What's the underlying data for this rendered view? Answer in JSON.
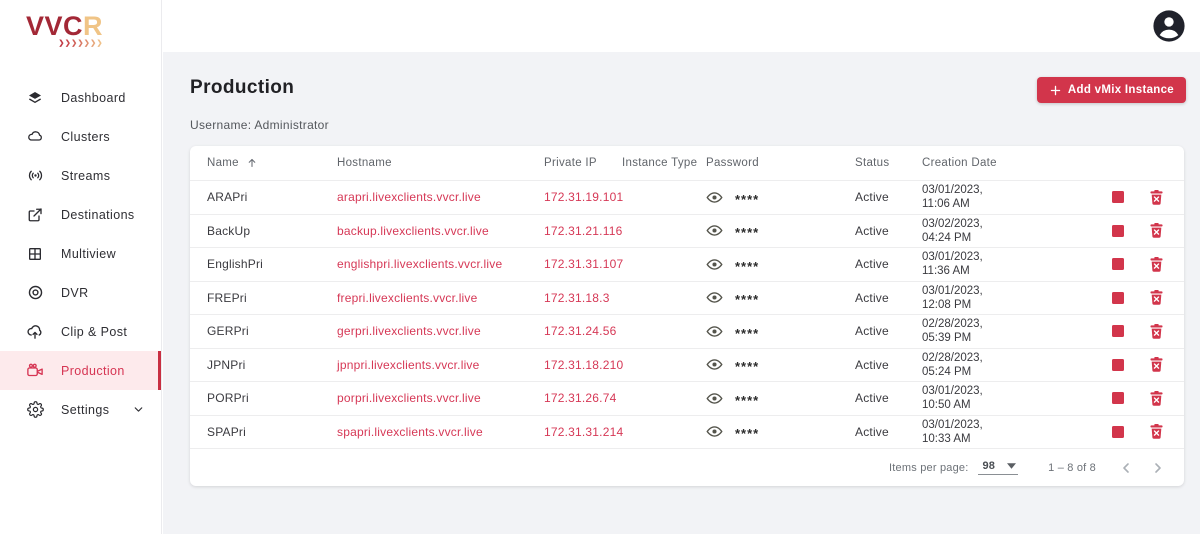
{
  "brand": {
    "logo_text_primary": "VVC",
    "logo_text_accent": "R",
    "logo_chevrons": "❯❯❯❯❯❯❯"
  },
  "sidebar": {
    "items": [
      {
        "label": "Dashboard"
      },
      {
        "label": "Clusters"
      },
      {
        "label": "Streams"
      },
      {
        "label": "Destinations"
      },
      {
        "label": "Multiview"
      },
      {
        "label": "DVR"
      },
      {
        "label": "Clip & Post"
      },
      {
        "label": "Production",
        "active": true
      },
      {
        "label": "Settings"
      }
    ]
  },
  "page": {
    "title": "Production",
    "subtitle": "Username: Administrator",
    "add_button_label": "Add vMix Instance"
  },
  "table": {
    "columns": [
      "Name",
      "Hostname",
      "Private IP",
      "Instance Type",
      "Password",
      "Status",
      "Creation Date"
    ],
    "rows": [
      {
        "name": "ARAPri",
        "hostname": "arapri.livexclients.vvcr.live",
        "private_ip": "172.31.19.101",
        "instance_type": "",
        "password": "****",
        "status": "Active",
        "creation_date_line1": "03/01/2023,",
        "creation_date_line2": "11:06 AM"
      },
      {
        "name": "BackUp",
        "hostname": "backup.livexclients.vvcr.live",
        "private_ip": "172.31.21.116",
        "instance_type": "",
        "password": "****",
        "status": "Active",
        "creation_date_line1": "03/02/2023,",
        "creation_date_line2": "04:24 PM"
      },
      {
        "name": "EnglishPri",
        "hostname": "englishpri.livexclients.vvcr.live",
        "private_ip": "172.31.31.107",
        "instance_type": "",
        "password": "****",
        "status": "Active",
        "creation_date_line1": "03/01/2023,",
        "creation_date_line2": "11:36 AM"
      },
      {
        "name": "FREPri",
        "hostname": "frepri.livexclients.vvcr.live",
        "private_ip": "172.31.18.3",
        "instance_type": "",
        "password": "****",
        "status": "Active",
        "creation_date_line1": "03/01/2023,",
        "creation_date_line2": "12:08 PM"
      },
      {
        "name": "GERPri",
        "hostname": "gerpri.livexclients.vvcr.live",
        "private_ip": "172.31.24.56",
        "instance_type": "",
        "password": "****",
        "status": "Active",
        "creation_date_line1": "02/28/2023,",
        "creation_date_line2": "05:39 PM"
      },
      {
        "name": "JPNPri",
        "hostname": "jpnpri.livexclients.vvcr.live",
        "private_ip": "172.31.18.210",
        "instance_type": "",
        "password": "****",
        "status": "Active",
        "creation_date_line1": "02/28/2023,",
        "creation_date_line2": "05:24 PM"
      },
      {
        "name": "PORPri",
        "hostname": "porpri.livexclients.vvcr.live",
        "private_ip": "172.31.26.74",
        "instance_type": "",
        "password": "****",
        "status": "Active",
        "creation_date_line1": "03/01/2023,",
        "creation_date_line2": "10:50 AM"
      },
      {
        "name": "SPAPri",
        "hostname": "spapri.livexclients.vvcr.live",
        "private_ip": "172.31.31.214",
        "instance_type": "",
        "password": "****",
        "status": "Active",
        "creation_date_line1": "03/01/2023,",
        "creation_date_line2": "10:33 AM"
      }
    ]
  },
  "paginator": {
    "items_per_page_label": "Items per page:",
    "items_per_page_value": "98",
    "range_label": "1 – 8 of 8"
  },
  "colors": {
    "accent_red": "#d2354b",
    "link_red": "#d63856",
    "active_item_bg": "#fdeaec",
    "content_bg": "#f2f3f6",
    "logo_dark_red": "#a32836",
    "logo_tan": "#f0c486"
  }
}
